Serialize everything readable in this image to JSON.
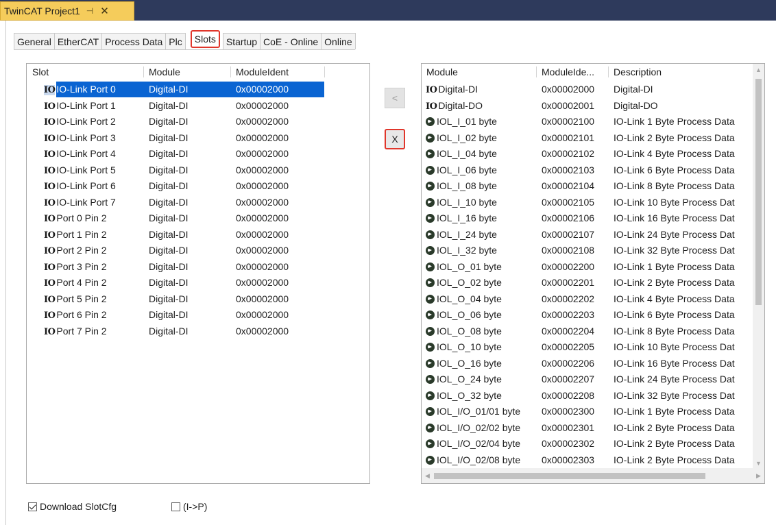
{
  "document_tab": {
    "title": "TwinCAT Project1",
    "pin_glyph": "⊣",
    "close_glyph": "✕"
  },
  "tabs": [
    "General",
    "EtherCAT",
    "Process Data",
    "Plc",
    "Slots",
    "Startup",
    "CoE - Online",
    "Online"
  ],
  "active_tab": "Slots",
  "slots": {
    "headers": [
      "Slot",
      "Module",
      "ModuleIdent"
    ],
    "rows": [
      {
        "icon": "IO",
        "slot": "IO-Link Port 0",
        "module": "Digital-DI",
        "ident": "0x00002000",
        "selected": true
      },
      {
        "icon": "IO",
        "slot": "IO-Link Port 1",
        "module": "Digital-DI",
        "ident": "0x00002000"
      },
      {
        "icon": "IO",
        "slot": "IO-Link Port 2",
        "module": "Digital-DI",
        "ident": "0x00002000"
      },
      {
        "icon": "IO",
        "slot": "IO-Link Port 3",
        "module": "Digital-DI",
        "ident": "0x00002000"
      },
      {
        "icon": "IO",
        "slot": "IO-Link Port 4",
        "module": "Digital-DI",
        "ident": "0x00002000"
      },
      {
        "icon": "IO",
        "slot": "IO-Link Port 5",
        "module": "Digital-DI",
        "ident": "0x00002000"
      },
      {
        "icon": "IO",
        "slot": "IO-Link Port 6",
        "module": "Digital-DI",
        "ident": "0x00002000"
      },
      {
        "icon": "IO",
        "slot": "IO-Link Port 7",
        "module": "Digital-DI",
        "ident": "0x00002000"
      },
      {
        "icon": "IO",
        "slot": "Port 0 Pin 2",
        "module": "Digital-DI",
        "ident": "0x00002000"
      },
      {
        "icon": "IO",
        "slot": "Port 1 Pin 2",
        "module": "Digital-DI",
        "ident": "0x00002000"
      },
      {
        "icon": "IO",
        "slot": "Port 2 Pin 2",
        "module": "Digital-DI",
        "ident": "0x00002000"
      },
      {
        "icon": "IO",
        "slot": "Port 3 Pin 2",
        "module": "Digital-DI",
        "ident": "0x00002000"
      },
      {
        "icon": "IO",
        "slot": "Port 4 Pin 2",
        "module": "Digital-DI",
        "ident": "0x00002000"
      },
      {
        "icon": "IO",
        "slot": "Port 5 Pin 2",
        "module": "Digital-DI",
        "ident": "0x00002000"
      },
      {
        "icon": "IO",
        "slot": "Port 6 Pin 2",
        "module": "Digital-DI",
        "ident": "0x00002000"
      },
      {
        "icon": "IO",
        "slot": "Port 7 Pin 2",
        "module": "Digital-DI",
        "ident": "0x00002000"
      }
    ]
  },
  "modules": {
    "headers": [
      "Module",
      "ModuleIde...",
      "Description"
    ],
    "rows": [
      {
        "icon": "io",
        "module": "Digital-DI",
        "ident": "0x00002000",
        "desc": "Digital-DI"
      },
      {
        "icon": "io",
        "module": "Digital-DO",
        "ident": "0x00002001",
        "desc": "Digital-DO"
      },
      {
        "icon": "iolink",
        "module": "IOL_I_01 byte",
        "ident": "0x00002100",
        "desc": "IO-Link 1 Byte Process Data"
      },
      {
        "icon": "iolink",
        "module": "IOL_I_02 byte",
        "ident": "0x00002101",
        "desc": "IO-Link 2 Byte Process Data"
      },
      {
        "icon": "iolink",
        "module": "IOL_I_04 byte",
        "ident": "0x00002102",
        "desc": "IO-Link 4 Byte Process Data"
      },
      {
        "icon": "iolink",
        "module": "IOL_I_06 byte",
        "ident": "0x00002103",
        "desc": "IO-Link 6 Byte Process Data"
      },
      {
        "icon": "iolink",
        "module": "IOL_I_08 byte",
        "ident": "0x00002104",
        "desc": "IO-Link 8 Byte Process Data"
      },
      {
        "icon": "iolink",
        "module": "IOL_I_10 byte",
        "ident": "0x00002105",
        "desc": "IO-Link 10 Byte Process Dat"
      },
      {
        "icon": "iolink",
        "module": "IOL_I_16 byte",
        "ident": "0x00002106",
        "desc": "IO-Link 16 Byte Process Dat"
      },
      {
        "icon": "iolink",
        "module": "IOL_I_24 byte",
        "ident": "0x00002107",
        "desc": "IO-Link 24 Byte Process Dat"
      },
      {
        "icon": "iolink",
        "module": "IOL_I_32 byte",
        "ident": "0x00002108",
        "desc": "IO-Link 32 Byte Process Dat"
      },
      {
        "icon": "iolink",
        "module": "IOL_O_01 byte",
        "ident": "0x00002200",
        "desc": "IO-Link 1 Byte Process Data"
      },
      {
        "icon": "iolink",
        "module": "IOL_O_02 byte",
        "ident": "0x00002201",
        "desc": "IO-Link 2 Byte Process Data"
      },
      {
        "icon": "iolink",
        "module": "IOL_O_04 byte",
        "ident": "0x00002202",
        "desc": "IO-Link 4 Byte Process Data"
      },
      {
        "icon": "iolink",
        "module": "IOL_O_06 byte",
        "ident": "0x00002203",
        "desc": "IO-Link 6 Byte Process Data"
      },
      {
        "icon": "iolink",
        "module": "IOL_O_08 byte",
        "ident": "0x00002204",
        "desc": "IO-Link 8 Byte Process Data"
      },
      {
        "icon": "iolink",
        "module": "IOL_O_10 byte",
        "ident": "0x00002205",
        "desc": "IO-Link 10 Byte Process Dat"
      },
      {
        "icon": "iolink",
        "module": "IOL_O_16 byte",
        "ident": "0x00002206",
        "desc": "IO-Link 16 Byte Process Dat"
      },
      {
        "icon": "iolink",
        "module": "IOL_O_24 byte",
        "ident": "0x00002207",
        "desc": "IO-Link 24 Byte Process Dat"
      },
      {
        "icon": "iolink",
        "module": "IOL_O_32 byte",
        "ident": "0x00002208",
        "desc": "IO-Link 32 Byte Process Dat"
      },
      {
        "icon": "iolink",
        "module": "IOL_I/O_01/01 byte",
        "ident": "0x00002300",
        "desc": "IO-Link 1 Byte Process Data"
      },
      {
        "icon": "iolink",
        "module": "IOL_I/O_02/02 byte",
        "ident": "0x00002301",
        "desc": "IO-Link 2 Byte Process Data"
      },
      {
        "icon": "iolink",
        "module": "IOL_I/O_02/04 byte",
        "ident": "0x00002302",
        "desc": "IO-Link 2 Byte Process Data"
      },
      {
        "icon": "iolink",
        "module": "IOL_I/O_02/08 byte",
        "ident": "0x00002303",
        "desc": "IO-Link 2 Byte Process Data"
      }
    ]
  },
  "buttons": {
    "add": "<",
    "remove": "X"
  },
  "scroll_glyphs": {
    "up": "▲",
    "down": "▼",
    "left": "◀",
    "right": "▶"
  },
  "options": {
    "download_slotcfg": {
      "label": "Download SlotCfg",
      "checked": true
    },
    "i_to_p": {
      "label": "(I->P)",
      "checked": false
    }
  },
  "colors": {
    "selection": "#0a64d2",
    "highlight_border": "#e0362b",
    "doc_tab": "#f5cc5b",
    "doc_strip": "#2e3a5c"
  }
}
